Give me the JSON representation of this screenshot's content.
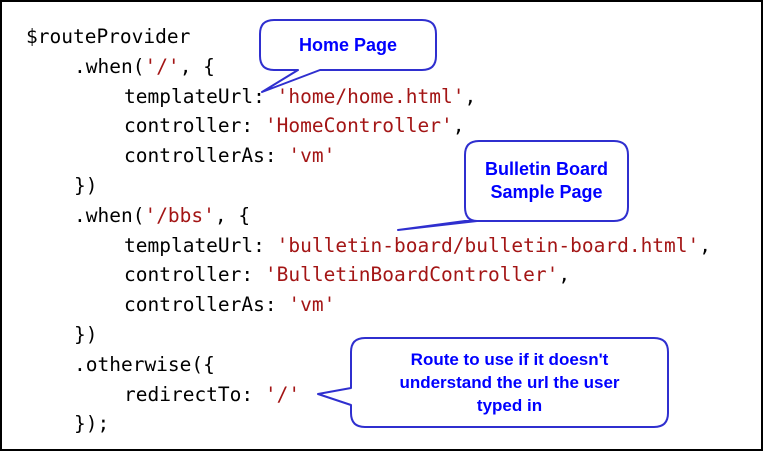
{
  "code": {
    "l1": {
      "a": "$routeProvider"
    },
    "l2": {
      "a": ".when(",
      "s": "'/'",
      "b": ", {"
    },
    "l3": {
      "a": "templateUrl: ",
      "s": "'home/home.html'",
      "b": ","
    },
    "l4": {
      "a": "controller: ",
      "s": "'HomeController'",
      "b": ","
    },
    "l5": {
      "a": "controllerAs: ",
      "s": "'vm'",
      "b": ""
    },
    "l6": {
      "a": "})"
    },
    "l7": {
      "a": ".when(",
      "s": "'/bbs'",
      "b": ", {"
    },
    "l8": {
      "a": "templateUrl: ",
      "s": "'bulletin-board/bulletin-board.html'",
      "b": ","
    },
    "l9": {
      "a": "controller: ",
      "s": "'BulletinBoardController'",
      "b": ","
    },
    "l10": {
      "a": "controllerAs: ",
      "s": "'vm'",
      "b": ""
    },
    "l11": {
      "a": "})"
    },
    "l12": {
      "a": ".otherwise({"
    },
    "l13": {
      "a": "redirectTo: ",
      "s": "'/'",
      "b": ""
    },
    "l14": {
      "a": "});"
    }
  },
  "callouts": {
    "home": {
      "line1": "Home Page"
    },
    "bbs": {
      "line1": "Bulletin Board",
      "line2": "Sample Page"
    },
    "otherwise": {
      "line1": "Route to use if  it doesn't",
      "line2": "understand the url the user",
      "line3": "typed in"
    }
  },
  "colors": {
    "string": "#a31515",
    "callout_text": "#0000ff",
    "callout_border": "#2f2fcf"
  }
}
